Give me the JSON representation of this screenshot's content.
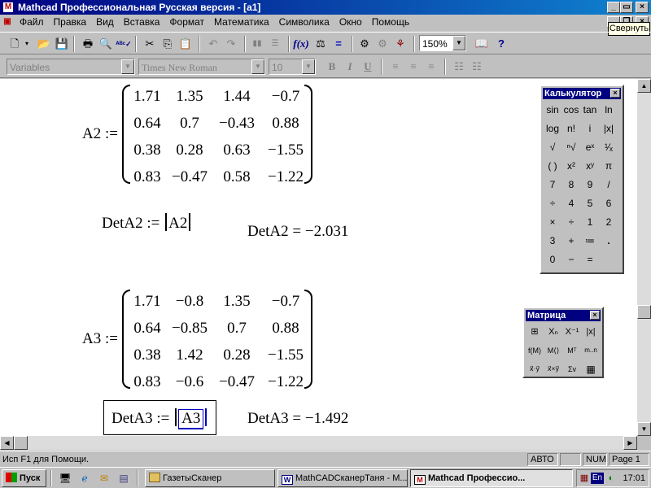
{
  "window": {
    "title": "Mathcad Профессиональная Русская версия - [a1]",
    "tooltip": "Свернуть"
  },
  "menu": [
    "Файл",
    "Правка",
    "Вид",
    "Вставка",
    "Формат",
    "Математика",
    "Символика",
    "Окно",
    "Помощь"
  ],
  "toolbar": {
    "zoom": "150%"
  },
  "format_bar": {
    "style": "Variables",
    "font": "Times New Roman",
    "size": "10",
    "bold": "B",
    "italic": "I",
    "underline": "U"
  },
  "document": {
    "a2": {
      "label": "A2 :=",
      "rows": [
        [
          "1.71",
          "1.35",
          "1.44",
          "−0.7"
        ],
        [
          "0.64",
          "0.7",
          "−0.43",
          "0.88"
        ],
        [
          "0.38",
          "0.28",
          "0.63",
          "−1.55"
        ],
        [
          "0.83",
          "−0.47",
          "0.58",
          "−1.22"
        ]
      ]
    },
    "det_a2_def": {
      "name": "DetA2 :=",
      "arg": "A2"
    },
    "det_a2_result": "DetA2 = −2.031",
    "a3": {
      "label": "A3 :=",
      "rows": [
        [
          "1.71",
          "−0.8",
          "1.35",
          "−0.7"
        ],
        [
          "0.64",
          "−0.85",
          "0.7",
          "0.88"
        ],
        [
          "0.38",
          "1.42",
          "0.28",
          "−1.55"
        ],
        [
          "0.83",
          "−0.6",
          "−0.47",
          "−1.22"
        ]
      ]
    },
    "det_a3_def": {
      "name": "DetA3 :=",
      "arg": "A3"
    },
    "det_a3_result": "DetA3 = −1.492"
  },
  "calculator": {
    "title": "Калькулятор",
    "keys": [
      [
        "sin",
        "cos",
        "tan",
        "ln"
      ],
      [
        "log",
        "n!",
        "i",
        "|x|"
      ],
      [
        "√",
        "ⁿ√",
        "eˣ",
        "¹⁄ₓ"
      ],
      [
        "( )",
        "x²",
        "xʸ",
        "π"
      ],
      [
        "7",
        "8",
        "9",
        "/"
      ],
      [
        "÷",
        "4",
        "5",
        "6"
      ],
      [
        "×",
        "÷",
        "1",
        "2"
      ],
      [
        "3",
        "+",
        "≔",
        "."
      ],
      [
        "0",
        "−",
        "="
      ]
    ]
  },
  "matrix_palette": {
    "title": "Матрица",
    "keys": [
      [
        "⊞",
        "Xₙ",
        "X⁻¹",
        "|x|"
      ],
      [
        "f(M)",
        "M⟨⟩",
        "Mᵀ",
        "m..n"
      ],
      [
        "x⃗·y⃗",
        "x⃗×y⃗",
        "Σv",
        "▦"
      ]
    ]
  },
  "status": {
    "message": "Исп F1 для Помощи.",
    "mode": "АВТО",
    "num": "NUM",
    "page": "Page 1"
  },
  "taskbar": {
    "start": "Пуск",
    "tasks": [
      "ГазетыСканер",
      "MathCADСканерТаня - M...",
      "Mathcad Профессио..."
    ],
    "lang": "En",
    "time": "17:01"
  }
}
